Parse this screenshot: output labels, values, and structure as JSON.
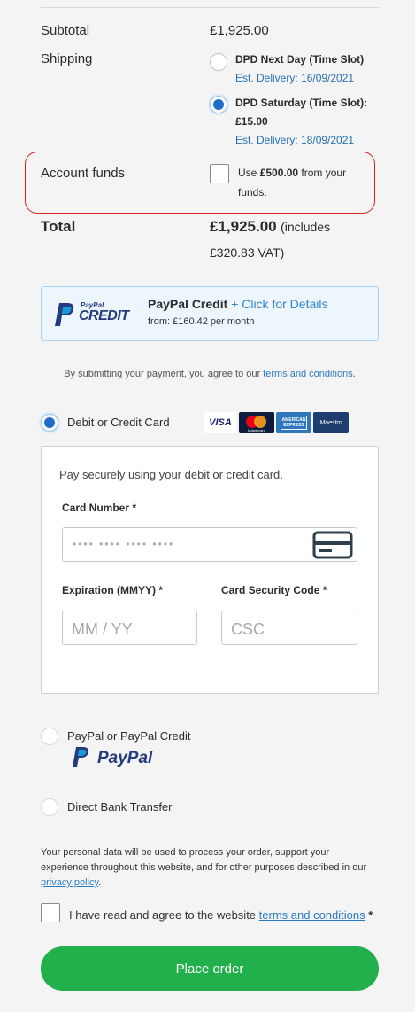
{
  "summary": {
    "subtotal_label": "Subtotal",
    "subtotal_value": "£1,925.00",
    "shipping_label": "Shipping",
    "shipping_options": [
      {
        "name": "DPD Next Day (Time Slot)",
        "estimate": "Est. Delivery: 16/09/2021",
        "selected": false
      },
      {
        "name_line1": "DPD Saturday (Time Slot):",
        "name_line2": "£15.00",
        "estimate": "Est. Delivery: 18/09/2021",
        "selected": true
      }
    ],
    "account_funds_label": "Account funds",
    "account_funds_pre": "Use ",
    "account_funds_amount": "£500.00",
    "account_funds_post": " from your",
    "account_funds_line2": "funds.",
    "total_label": "Total",
    "total_value": "£1,925.00",
    "total_vat_line1": "(includes",
    "total_vat_line2": "£320.83 VAT)"
  },
  "paypal_credit": {
    "logo_top": "PayPal",
    "logo_bottom": "CREDIT",
    "title": "PayPal Credit",
    "link": "+ Click for Details",
    "from_text": "from: £160.42 per month"
  },
  "terms_notice": {
    "text": "By submitting your payment, you agree to our ",
    "link": "terms and conditions",
    "end": "."
  },
  "payment_methods": {
    "card": {
      "label": "Debit or Credit Card",
      "selected": true,
      "card_logos": [
        "VISA",
        "Mastercard",
        "AMERICAN EXPRESS",
        "Maestro"
      ]
    },
    "card_form": {
      "intro": "Pay securely using your debit or credit card.",
      "card_number_label": "Card Number *",
      "card_number_placeholder": "•••• •••• •••• ••••",
      "expiration_label": "Expiration (MMYY) *",
      "expiration_placeholder": "MM / YY",
      "csc_label": "Card Security Code *",
      "csc_placeholder": "CSC"
    },
    "paypal": {
      "label": "PayPal or PayPal Credit",
      "logo_text": "PayPal"
    },
    "bank": {
      "label": "Direct Bank Transfer"
    }
  },
  "privacy": {
    "line1": "Your personal data will be used to process your order, support your",
    "line2": "experience throughout this website, and for other purposes described in our",
    "link": "privacy policy",
    "end": "."
  },
  "agree": {
    "text": "I have read and agree to the website ",
    "link": "terms and conditions",
    "required": "*"
  },
  "place_order": "Place order",
  "colors": {
    "accent_blue": "#1e6ec8",
    "place_order_green": "#21b04b",
    "highlight_red": "#d4202a",
    "paypal_navy": "#253b80",
    "paypal_light": "#179bd7"
  }
}
